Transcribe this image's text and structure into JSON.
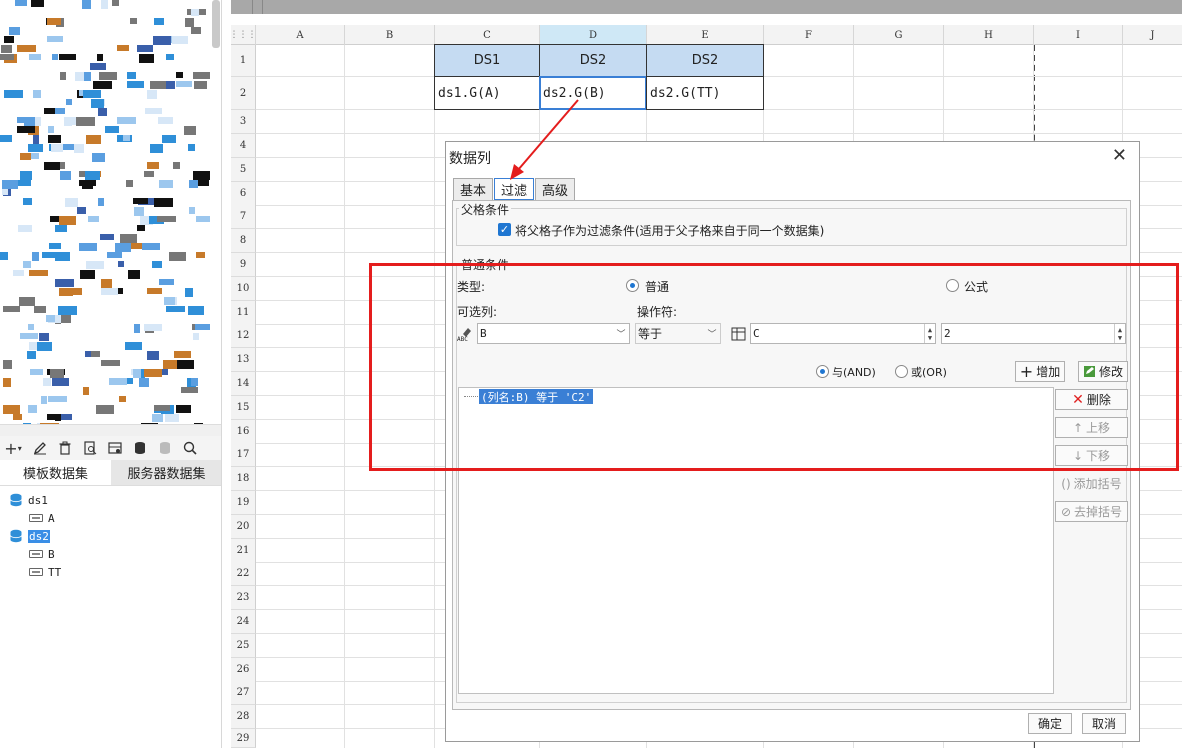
{
  "left_panel": {
    "toolbar_icons": [
      "add-icon",
      "edit-icon",
      "delete-icon",
      "preview-icon",
      "server-icon",
      "database-icon",
      "database-disabled-icon",
      "search-icon"
    ],
    "add_label": "+",
    "tabs": [
      "模板数据集",
      "服务器数据集"
    ],
    "tree": [
      {
        "label": "ds1",
        "type": "dataset",
        "selected": false
      },
      {
        "label": "A",
        "type": "field"
      },
      {
        "label": "ds2",
        "type": "dataset",
        "selected": true
      },
      {
        "label": "B",
        "type": "field"
      },
      {
        "label": "TT",
        "type": "field"
      }
    ]
  },
  "sheet": {
    "columns": [
      "A",
      "B",
      "C",
      "D",
      "E",
      "F",
      "G",
      "H",
      "I",
      "J"
    ],
    "selected_column": "D",
    "rows": [
      "1",
      "2",
      "3",
      "4",
      "5",
      "6",
      "7",
      "8",
      "9",
      "10",
      "11",
      "12",
      "13",
      "14",
      "15",
      "16",
      "17",
      "18",
      "19",
      "20",
      "21",
      "22",
      "23",
      "24",
      "25",
      "26",
      "27",
      "28",
      "29"
    ],
    "cells": {
      "C1": "DS1",
      "D1": "DS2",
      "E1": "DS2",
      "C2": "ds1.G(A)",
      "D2": "ds2.G(B)",
      "E2": "ds2.G(TT)"
    },
    "selected_cell": "D2"
  },
  "dialog": {
    "title": "数据列",
    "tabs": [
      "基本",
      "过滤",
      "高级"
    ],
    "active_tab": "过滤",
    "parent_section": {
      "legend": "父格条件",
      "checkbox_label": "将父格子作为过滤条件(适用于父子格来自于同一个数据集)",
      "checked": true
    },
    "normal_section": {
      "legend": "普通条件",
      "type_label": "类型:",
      "type_options": [
        "普通",
        "公式"
      ],
      "type_selected": "普通",
      "column_label": "可选列:",
      "operator_label": "操作符:",
      "column_value": "B",
      "operator_value": "等于",
      "cell_value": "C",
      "number_value": "2",
      "logic_options": [
        "与(AND)",
        "或(OR)"
      ],
      "logic_selected": "与(AND)",
      "add_button": "增加",
      "modify_button": "修改",
      "conditions": [
        "(列名:B) 等于 'C2'"
      ],
      "side_buttons": [
        {
          "label": "删除",
          "enabled": true,
          "icon": "x-icon"
        },
        {
          "label": "上移",
          "enabled": false,
          "icon": "arrow-up-icon"
        },
        {
          "label": "下移",
          "enabled": false,
          "icon": "arrow-down-icon"
        },
        {
          "label": "添加括号",
          "enabled": false,
          "icon": "bracket-icon"
        },
        {
          "label": "去掉括号",
          "enabled": false,
          "icon": "remove-bracket-icon"
        }
      ]
    },
    "ok_button": "确定",
    "cancel_button": "取消"
  },
  "colors": {
    "accent": "#1f76d1",
    "selection": "#3a7fd5",
    "header_cell": "#c5dbf2",
    "annotation": "#e41d1d"
  }
}
